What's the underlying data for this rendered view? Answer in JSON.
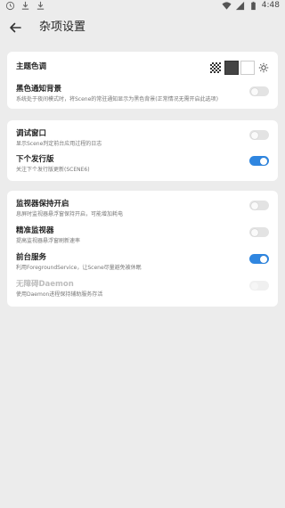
{
  "status_bar": {
    "time": "4:48",
    "left_icons": [
      "clock-icon",
      "download-icon",
      "download-icon"
    ],
    "right_icons": [
      "wifi-icon",
      "signal-icon",
      "battery-icon"
    ]
  },
  "header": {
    "back_icon": "arrow-back-icon",
    "title": "杂项设置"
  },
  "theme": {
    "label": "主题色调",
    "options": [
      "transparent-checker",
      "dark",
      "light",
      "auto-sun-icon"
    ]
  },
  "card1": {
    "black_notify": {
      "title": "黑色通知背景",
      "subtitle": "系统处于夜间模式时，将Scene的常驻通知显示为黑色背景(正常情况无需开启此选项)",
      "checked": false
    }
  },
  "card2": {
    "debug_window": {
      "title": "调试窗口",
      "subtitle": "显示Scene判定前台应用过程的日志",
      "checked": false
    },
    "next_release": {
      "title": "下个发行版",
      "subtitle": "关注下个发行版更新(SCENE6)",
      "checked": true
    }
  },
  "card3": {
    "monitor_keep": {
      "title": "监视器保持开启",
      "subtitle": "息屏时监视器悬浮窗保持开启，可能增加耗电",
      "checked": false
    },
    "precise_monitor": {
      "title": "精准监视器",
      "subtitle": "提高监视器悬浮窗刷新速率",
      "checked": false
    },
    "foreground_service": {
      "title": "前台服务",
      "subtitle": "利用ForegroundService，让Scene尽量避免被休眠",
      "checked": true
    },
    "barrier_free_daemon": {
      "title": "无障碍Daemon",
      "subtitle": "使用Daemon进程保持辅助服务存活",
      "checked": false,
      "disabled": true
    }
  },
  "colors": {
    "accent": "#2f86e0",
    "background": "#ececec",
    "card": "#ffffff"
  }
}
